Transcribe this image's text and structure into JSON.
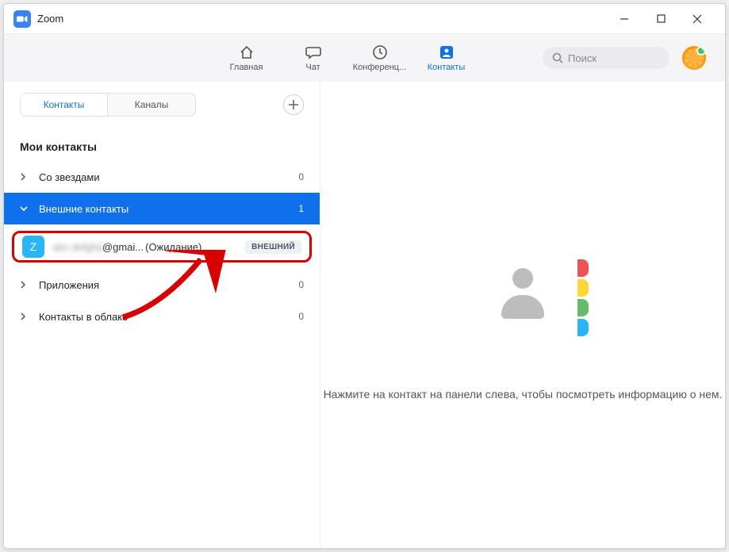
{
  "window": {
    "title": "Zoom"
  },
  "nav": {
    "home": "Главная",
    "chat": "Чат",
    "meetings": "Конференц...",
    "contacts": "Контакты"
  },
  "search": {
    "placeholder": "Поиск"
  },
  "sidebar": {
    "tabs": {
      "contacts": "Контакты",
      "channels": "Каналы"
    },
    "section": "Мои контакты",
    "groups": {
      "starred": {
        "label": "Со звездами",
        "count": "0"
      },
      "external": {
        "label": "Внешние контакты",
        "count": "1"
      },
      "apps": {
        "label": "Приложения",
        "count": "0"
      },
      "cloud": {
        "label": "Контакты в облаке",
        "count": "0"
      }
    },
    "contact": {
      "avatar_letter": "Z",
      "email_blur": "abc.defghij",
      "email_suffix": "@gmai...",
      "status": "(Ожидание)",
      "badge": "ВНЕШНИЙ"
    }
  },
  "content": {
    "hint": "Нажмите на контакт на панели слева, чтобы посмотреть информацию о нем.",
    "tab_colors": [
      "#ef5350",
      "#fdd835",
      "#66bb6a",
      "#29b6f6"
    ]
  }
}
